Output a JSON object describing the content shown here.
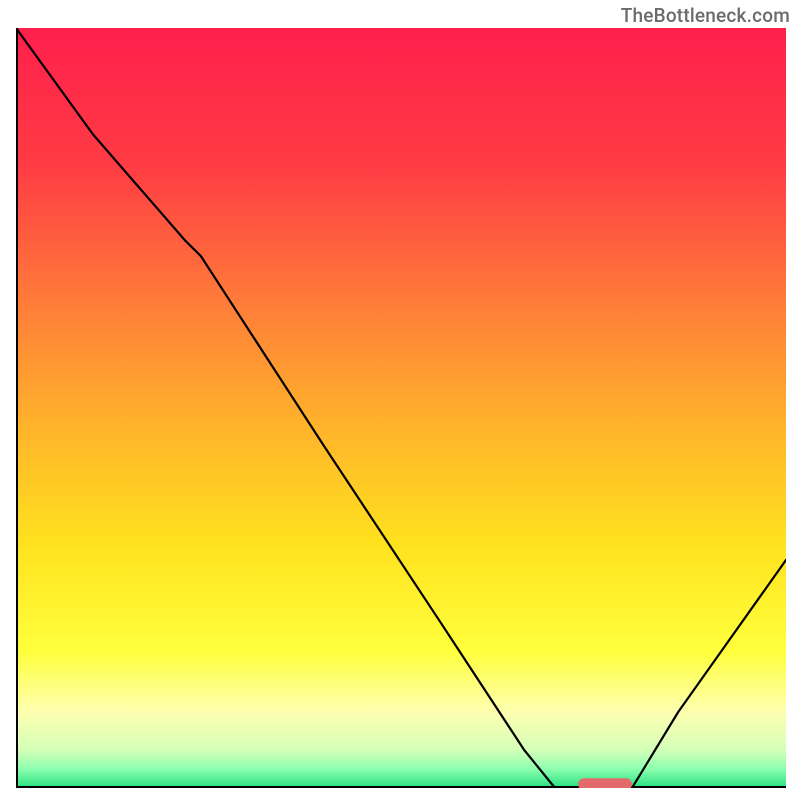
{
  "watermark": "TheBottleneck.com",
  "chart_data": {
    "type": "line",
    "title": "",
    "xlabel": "",
    "ylabel": "",
    "xlim": [
      0,
      100
    ],
    "ylim": [
      0,
      100
    ],
    "grid": false,
    "legend": false,
    "gradient_stops": [
      {
        "offset": 0.0,
        "color": "#ff1f4c"
      },
      {
        "offset": 0.18,
        "color": "#ff3b44"
      },
      {
        "offset": 0.35,
        "color": "#ff783a"
      },
      {
        "offset": 0.52,
        "color": "#ffb22b"
      },
      {
        "offset": 0.68,
        "color": "#ffe21e"
      },
      {
        "offset": 0.82,
        "color": "#ffff3c"
      },
      {
        "offset": 0.9,
        "color": "#fdffb0"
      },
      {
        "offset": 0.95,
        "color": "#d4ffb8"
      },
      {
        "offset": 0.975,
        "color": "#8cffaf"
      },
      {
        "offset": 1.0,
        "color": "#26e07f"
      }
    ],
    "series": [
      {
        "name": "bottleneck-curve",
        "color": "#000000",
        "stroke_width": 2.2,
        "points": [
          {
            "x": 0.0,
            "y": 100.0
          },
          {
            "x": 10.0,
            "y": 86.0
          },
          {
            "x": 22.0,
            "y": 72.0
          },
          {
            "x": 24.0,
            "y": 70.0
          },
          {
            "x": 40.0,
            "y": 45.0
          },
          {
            "x": 55.0,
            "y": 22.0
          },
          {
            "x": 66.0,
            "y": 5.0
          },
          {
            "x": 70.0,
            "y": 0.0
          },
          {
            "x": 74.0,
            "y": 0.0
          },
          {
            "x": 80.0,
            "y": 0.0
          },
          {
            "x": 86.0,
            "y": 10.0
          },
          {
            "x": 93.0,
            "y": 20.0
          },
          {
            "x": 100.0,
            "y": 30.0
          }
        ]
      }
    ],
    "marker": {
      "name": "optimal-zone",
      "x_start": 73.0,
      "x_end": 80.0,
      "y": 0.5,
      "color": "#e36a6a"
    },
    "axes": {
      "left": {
        "visible": true,
        "color": "#000000"
      },
      "bottom": {
        "visible": true,
        "color": "#000000"
      }
    }
  }
}
